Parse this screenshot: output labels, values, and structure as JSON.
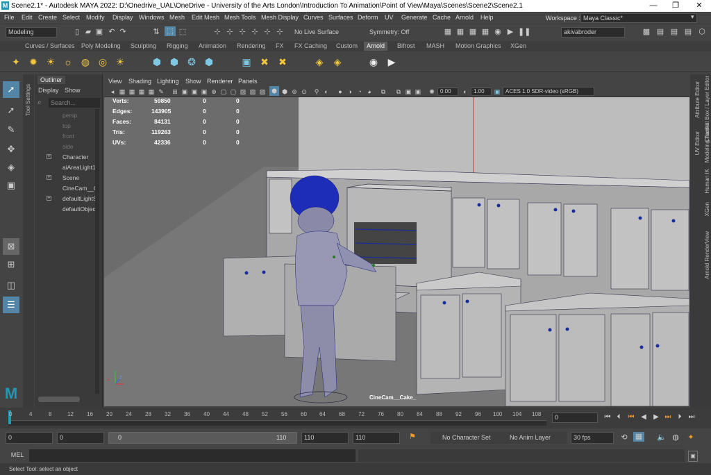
{
  "window": {
    "title": "Scene2.1* - Autodesk MAYA 2022: D:\\Onedrive_UAL\\OneDrive - University of the Arts London\\Introduction To Animation\\Point of View\\Maya\\Scenes\\Scene2\\Scene2.1",
    "logo": "M",
    "minimize": "—",
    "restore": "❐",
    "close": "✕"
  },
  "menu": [
    "File",
    "Edit",
    "Create",
    "Select",
    "Modify",
    "Display",
    "Windows",
    "Mesh",
    "Edit Mesh",
    "Mesh Tools",
    "Mesh Display",
    "Curves",
    "Surfaces",
    "Deform",
    "UV",
    "Generate",
    "Cache",
    "Arnold",
    "Help"
  ],
  "workspace": {
    "label": "Workspace :",
    "value": "Maya Classic*"
  },
  "statusline": {
    "mode": "Modeling",
    "live_surface": "No Live Surface",
    "symmetry": "Symmetry: Off",
    "user": "akivabroder"
  },
  "shelf_tabs": [
    "Curves / Surfaces",
    "Poly Modeling",
    "Sculpting",
    "Rigging",
    "Animation",
    "Rendering",
    "FX",
    "FX Caching",
    "Custom",
    "Arnold",
    "Bifrost",
    "MASH",
    "Motion Graphics",
    "XGen"
  ],
  "shelf_active": "Arnold",
  "left_strip_label": "Tool Settings",
  "outliner": {
    "title": "Outliner",
    "display": "Display",
    "show": "Show",
    "search_placeholder": "Search...",
    "items": [
      {
        "label": "persp",
        "dim": true
      },
      {
        "label": "top",
        "dim": true
      },
      {
        "label": "front",
        "dim": true
      },
      {
        "label": "side",
        "dim": true
      },
      {
        "label": "Character",
        "dim": false
      },
      {
        "label": "aiAreaLight1",
        "dim": false
      },
      {
        "label": "Scene",
        "dim": false
      },
      {
        "label": "CineCam__C",
        "dim": false
      },
      {
        "label": "defaultLightS",
        "dim": false
      },
      {
        "label": "defaultObjec",
        "dim": false
      }
    ]
  },
  "viewport_menu": [
    "View",
    "Shading",
    "Lighting",
    "Show",
    "Renderer",
    "Panels"
  ],
  "viewport_fields": {
    "near": "0.00",
    "far": "1.00",
    "colorspace": "ACES 1.0 SDR-video (sRGB)"
  },
  "hud": [
    {
      "label": "Verts:",
      "v1": "59850",
      "v2": "0",
      "v3": "0"
    },
    {
      "label": "Edges:",
      "v1": "143905",
      "v2": "0",
      "v3": "0"
    },
    {
      "label": "Faces:",
      "v1": "84131",
      "v2": "0",
      "v3": "0"
    },
    {
      "label": "Tris:",
      "v1": "119263",
      "v2": "0",
      "v3": "0"
    },
    {
      "label": "UVs:",
      "v1": "42336",
      "v2": "0",
      "v3": "0"
    }
  ],
  "camera_label": "CineCam__Cake_",
  "axis": {
    "x": "x",
    "y": "y",
    "z": "z"
  },
  "right_strip": [
    "Channel Box / Layer Editor",
    "Attribute Editor",
    "Modeling Toolkit",
    "UV Editor",
    "Human IK",
    "XGen",
    "Arnold RenderView"
  ],
  "timeline": {
    "ticks": [
      "0",
      "4",
      "8",
      "12",
      "16",
      "20",
      "24",
      "28",
      "32",
      "36",
      "40",
      "44",
      "48",
      "52",
      "56",
      "60",
      "64",
      "68",
      "72",
      "76",
      "80",
      "84",
      "88",
      "92",
      "96",
      "100",
      "104",
      "108"
    ],
    "current_frame": "0"
  },
  "range": {
    "start": "0",
    "anim_start": "0",
    "slider_start": "0",
    "slider_end": "110",
    "anim_end": "110",
    "end": "110",
    "character_set": "No Character Set",
    "anim_layer": "No Anim Layer",
    "fps": "30 fps"
  },
  "mel": {
    "label": "MEL"
  },
  "helpline": "Select Tool: select an object"
}
